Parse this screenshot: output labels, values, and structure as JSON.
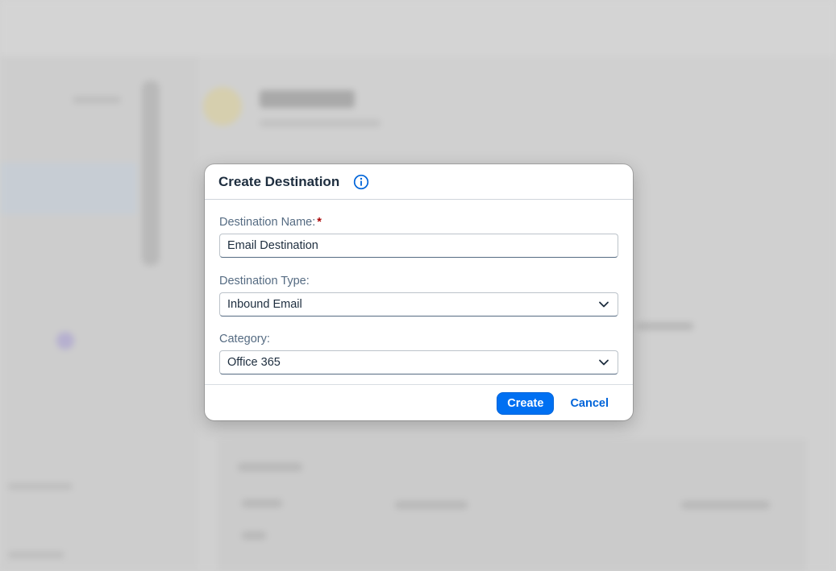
{
  "dialog": {
    "title": "Create Destination",
    "fields": {
      "name": {
        "label": "Destination Name:",
        "required_marker": "*",
        "value": "Email Destination"
      },
      "type": {
        "label": "Destination Type:",
        "value": "Inbound Email"
      },
      "category": {
        "label": "Category:",
        "value": "Office 365"
      }
    },
    "buttons": {
      "create": "Create",
      "cancel": "Cancel"
    }
  },
  "icons": {
    "info": "info-icon",
    "chevron": "chevron-down-icon"
  },
  "colors": {
    "accent": "#0070f2",
    "title": "#1d2d3e",
    "label": "#556b82",
    "required": "#aa0808"
  }
}
